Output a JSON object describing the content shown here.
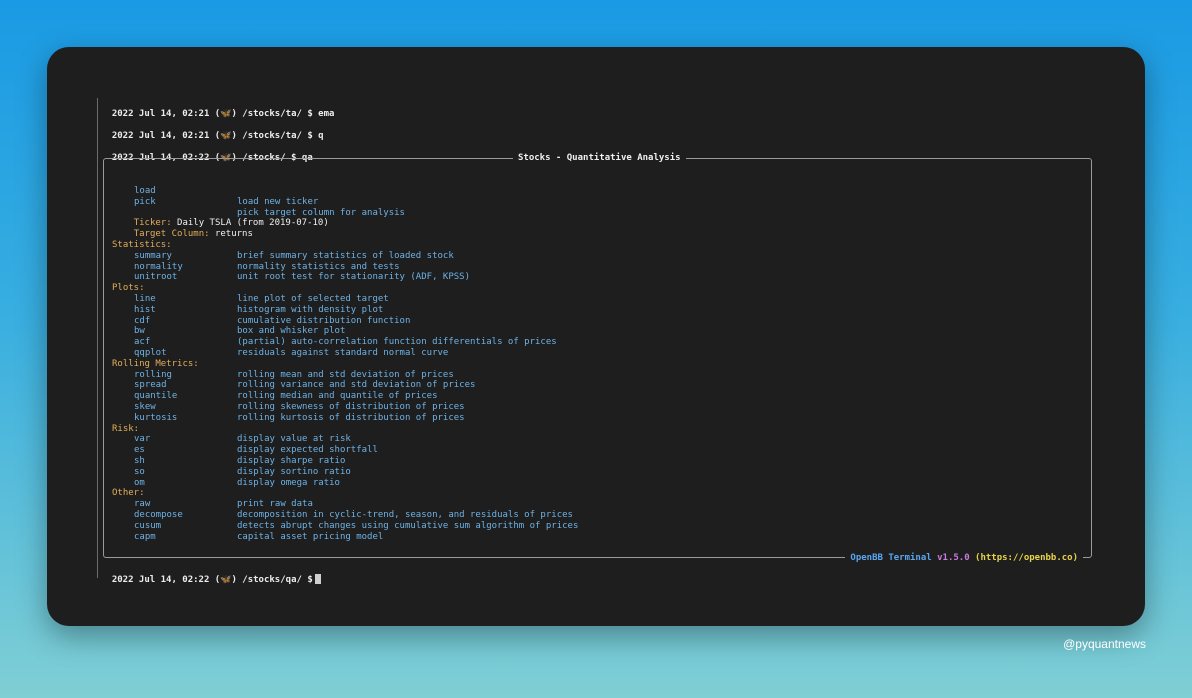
{
  "history": [
    {
      "timestamp": "2022 Jul 14, 02:21",
      "icon": "butterfly-icon",
      "path": "/stocks/ta/",
      "command": "ema"
    },
    {
      "timestamp": "2022 Jul 14, 02:21",
      "icon": "butterfly-icon",
      "path": "/stocks/ta/",
      "command": "q"
    },
    {
      "timestamp": "2022 Jul 14, 02:22",
      "icon": "butterfly-icon",
      "path": "/stocks/",
      "command": "qa"
    }
  ],
  "menu": {
    "title": "Stocks - Quantitative Analysis",
    "top_commands": [
      {
        "cmd": "load",
        "desc": "load new ticker"
      },
      {
        "cmd": "pick",
        "desc": "pick target column for analysis"
      }
    ],
    "ticker_label": "Ticker:",
    "ticker_value": "Daily TSLA (from 2019-07-10)",
    "target_label": "Target Column:",
    "target_value": "returns",
    "sections": [
      {
        "title": "Statistics:",
        "items": [
          {
            "cmd": "summary",
            "desc": "brief summary statistics of loaded stock"
          },
          {
            "cmd": "normality",
            "desc": "normality statistics and tests"
          },
          {
            "cmd": "unitroot",
            "desc": "unit root test for stationarity (ADF, KPSS)"
          }
        ]
      },
      {
        "title": "Plots:",
        "items": [
          {
            "cmd": "line",
            "desc": "line plot of selected target"
          },
          {
            "cmd": "hist",
            "desc": "histogram with density plot"
          },
          {
            "cmd": "cdf",
            "desc": "cumulative distribution function"
          },
          {
            "cmd": "bw",
            "desc": "box and whisker plot"
          },
          {
            "cmd": "acf",
            "desc": "(partial) auto-correlation function differentials of prices"
          },
          {
            "cmd": "qqplot",
            "desc": "residuals against standard normal curve"
          }
        ]
      },
      {
        "title": "Rolling Metrics:",
        "items": [
          {
            "cmd": "rolling",
            "desc": "rolling mean and std deviation of prices"
          },
          {
            "cmd": "spread",
            "desc": "rolling variance and std deviation of prices"
          },
          {
            "cmd": "quantile",
            "desc": "rolling median and quantile of prices"
          },
          {
            "cmd": "skew",
            "desc": "rolling skewness of distribution of prices"
          },
          {
            "cmd": "kurtosis",
            "desc": "rolling kurtosis of distribution of prices"
          }
        ]
      },
      {
        "title": "Risk:",
        "items": [
          {
            "cmd": "var",
            "desc": "display value at risk"
          },
          {
            "cmd": "es",
            "desc": "display expected shortfall"
          },
          {
            "cmd": "sh",
            "desc": "display sharpe ratio"
          },
          {
            "cmd": "so",
            "desc": "display sortino ratio"
          },
          {
            "cmd": "om",
            "desc": "display omega ratio"
          }
        ]
      },
      {
        "title": "Other:",
        "items": [
          {
            "cmd": "raw",
            "desc": "print raw data"
          },
          {
            "cmd": "decompose",
            "desc": "decomposition in cyclic-trend, season, and residuals of prices"
          },
          {
            "cmd": "cusum",
            "desc": "detects abrupt changes using cumulative sum algorithm of prices"
          },
          {
            "cmd": "capm",
            "desc": "capital asset pricing model"
          }
        ]
      }
    ],
    "footer": {
      "name": "OpenBB Terminal",
      "version": "v1.5.0",
      "url": "(https://openbb.co)"
    }
  },
  "prompt": {
    "timestamp": "2022 Jul 14, 02:22",
    "icon": "butterfly-icon",
    "path": "/stocks/qa/",
    "symbol": "$"
  },
  "watermark": "@pyquantnews",
  "colors": {
    "background_top": "#1a9ae4",
    "background_bottom": "#7fcfd4",
    "terminal_bg": "#1e1e1e",
    "command_text": "#6eb2e6",
    "section_header": "#e3ad5b",
    "footer_name": "#5aa5f0",
    "footer_version": "#c87adf",
    "footer_url": "#e8d34a"
  }
}
